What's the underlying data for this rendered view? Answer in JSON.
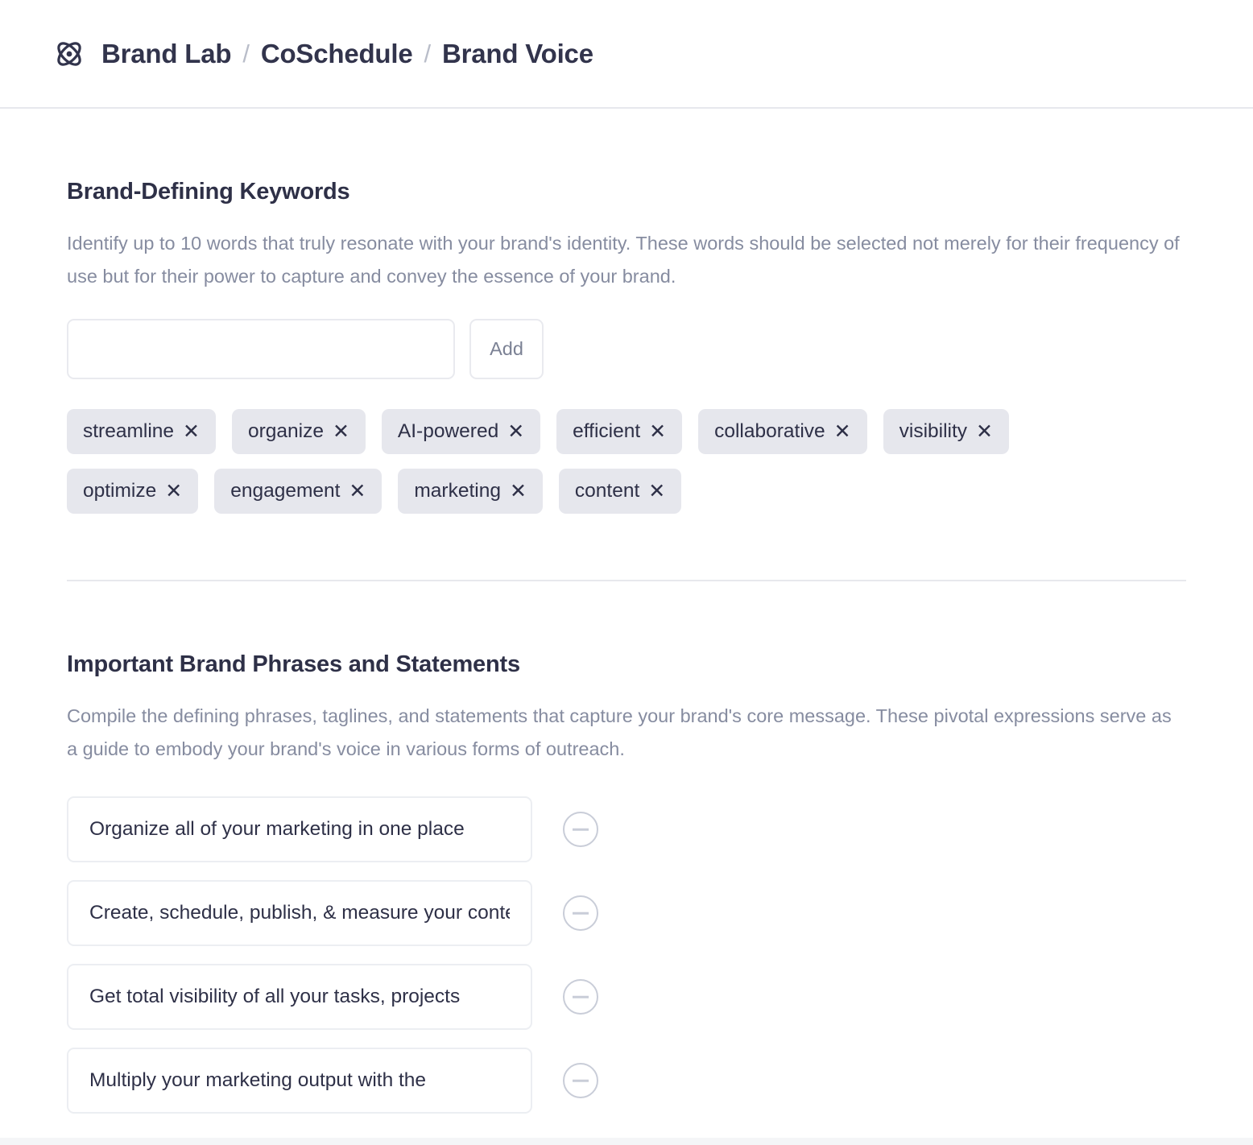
{
  "header": {
    "logo_icon": "atom-icon",
    "breadcrumb": [
      {
        "label": "Brand Lab"
      },
      {
        "label": "CoSchedule"
      },
      {
        "label": "Brand Voice"
      }
    ],
    "separator": "/"
  },
  "keywords_section": {
    "title": "Brand-Defining Keywords",
    "description": "Identify up to 10 words that truly resonate with your brand's identity. These words should be selected not merely for their frequency of use but for their power to capture and convey the essence of your brand.",
    "input": {
      "value": "",
      "placeholder": ""
    },
    "add_label": "Add",
    "remove_glyph": "✕",
    "chips": [
      {
        "label": "streamline"
      },
      {
        "label": "organize"
      },
      {
        "label": "AI-powered"
      },
      {
        "label": "efficient"
      },
      {
        "label": "collaborative"
      },
      {
        "label": "visibility"
      },
      {
        "label": "optimize"
      },
      {
        "label": "engagement"
      },
      {
        "label": "marketing"
      },
      {
        "label": "content"
      }
    ]
  },
  "phrases_section": {
    "title": "Important Brand Phrases and Statements",
    "description": "Compile the defining phrases, taglines, and statements that capture your brand's core message. These pivotal expressions serve as a guide to embody your brand's voice in various forms of outreach.",
    "rows": [
      {
        "value": "Organize all of your marketing in one place"
      },
      {
        "value": "Create, schedule, publish, & measure your content"
      },
      {
        "value": "Get total visibility of all your tasks, projects"
      },
      {
        "value": "Multiply your marketing output with the"
      }
    ],
    "remove_icon": "minus-circle-icon"
  },
  "colors": {
    "text_dark": "#2e3047",
    "text_muted": "#868ca0",
    "chip_bg": "#e6e7ed",
    "border": "#e7e8ed"
  }
}
